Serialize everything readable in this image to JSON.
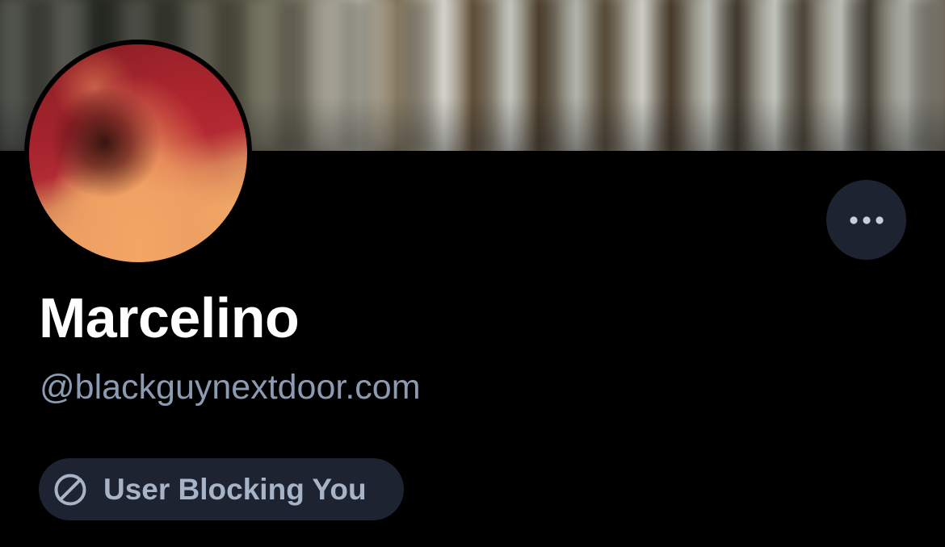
{
  "profile": {
    "display_name": "Marcelino",
    "handle": "@blackguynextdoor.com",
    "block_status_label": "User Blocking You"
  },
  "icons": {
    "more": "more-horizontal-icon",
    "block": "block-icon"
  },
  "colors": {
    "background": "#000000",
    "badge_background": "#1d2330",
    "handle_text": "#8d9bb2",
    "badge_text": "#a7b3c6",
    "name_text": "#ffffff"
  }
}
